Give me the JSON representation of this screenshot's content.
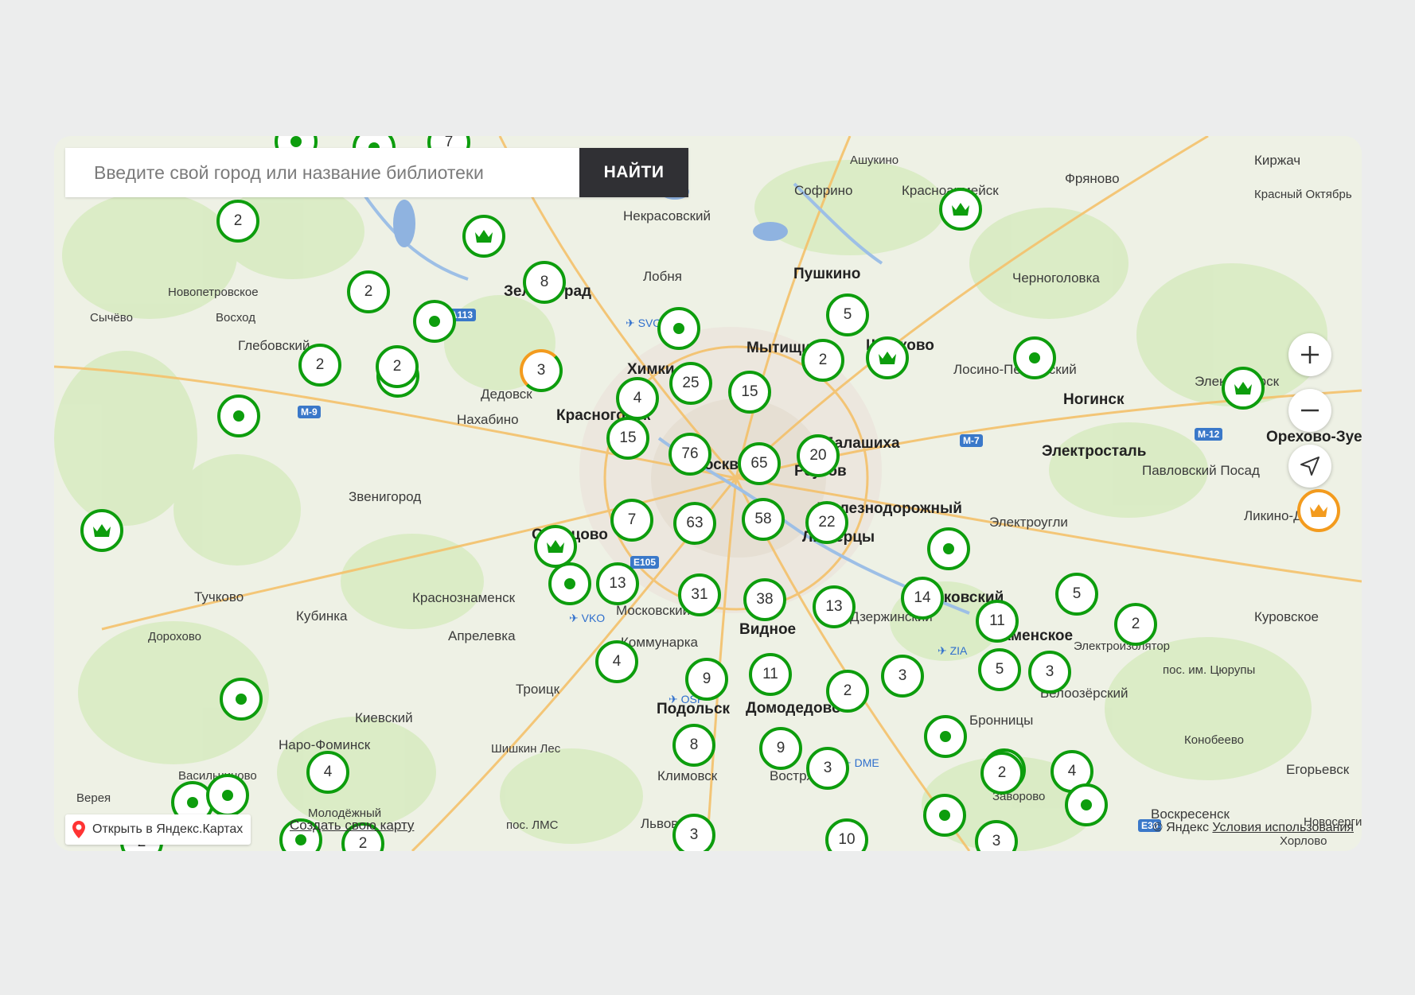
{
  "search": {
    "placeholder": "Введите свой город или название библиотеки",
    "button_label": "НАЙТИ"
  },
  "map_labels": [
    {
      "text": "Ашукино",
      "kind": "small"
    },
    {
      "text": "Софрино",
      "kind": "normal"
    },
    {
      "text": "Красноармейск",
      "kind": "normal"
    },
    {
      "text": "Фряново",
      "kind": "normal"
    },
    {
      "text": "Киржач",
      "kind": "normal"
    },
    {
      "text": "Красный Октябрь",
      "kind": "small"
    },
    {
      "text": "Некрасовский",
      "kind": "normal"
    },
    {
      "text": "Пушкино",
      "kind": "major"
    },
    {
      "text": "Черноголовка",
      "kind": "normal"
    },
    {
      "text": "Лобня",
      "kind": "normal"
    },
    {
      "text": "Зеленоград",
      "kind": "major"
    },
    {
      "text": "Новопетровское",
      "kind": "small"
    },
    {
      "text": "Сычёво",
      "kind": "small"
    },
    {
      "text": "Восход",
      "kind": "small"
    },
    {
      "text": "Глебовский",
      "kind": "normal"
    },
    {
      "text": "Мытищи",
      "kind": "major"
    },
    {
      "text": "Щёлково",
      "kind": "major"
    },
    {
      "text": "Лосино-Петровский",
      "kind": "normal"
    },
    {
      "text": "Химки",
      "kind": "major"
    },
    {
      "text": "Дедовск",
      "kind": "normal"
    },
    {
      "text": "Ногинск",
      "kind": "major"
    },
    {
      "text": "Электрогорск",
      "kind": "normal"
    },
    {
      "text": "Нахабино",
      "kind": "normal"
    },
    {
      "text": "Красногорск",
      "kind": "major"
    },
    {
      "text": "Балашиха",
      "kind": "major"
    },
    {
      "text": "Электросталь",
      "kind": "major"
    },
    {
      "text": "Орехово-Зуево",
      "kind": "major"
    },
    {
      "text": "Москва",
      "kind": "major"
    },
    {
      "text": "Реутов",
      "kind": "major"
    },
    {
      "text": "Павловский Посад",
      "kind": "normal"
    },
    {
      "text": "Звенигород",
      "kind": "normal"
    },
    {
      "text": "Железнодорожный",
      "kind": "major"
    },
    {
      "text": "Электроугли",
      "kind": "normal"
    },
    {
      "text": "Ликино-Дулёво",
      "kind": "normal"
    },
    {
      "text": "Одинцово",
      "kind": "major"
    },
    {
      "text": "Люберцы",
      "kind": "major"
    },
    {
      "text": "Тучково",
      "kind": "normal"
    },
    {
      "text": "Краснознаменск",
      "kind": "normal"
    },
    {
      "text": "Московский",
      "kind": "normal"
    },
    {
      "text": "Жуковский",
      "kind": "major"
    },
    {
      "text": "Куровское",
      "kind": "normal"
    },
    {
      "text": "Кубинка",
      "kind": "normal"
    },
    {
      "text": "Видное",
      "kind": "major"
    },
    {
      "text": "Дзержинский",
      "kind": "normal"
    },
    {
      "text": "Раменское",
      "kind": "major"
    },
    {
      "text": "Дорохово",
      "kind": "small"
    },
    {
      "text": "Апрелевка",
      "kind": "normal"
    },
    {
      "text": "Коммунарка",
      "kind": "normal"
    },
    {
      "text": "Электроизолятор",
      "kind": "small"
    },
    {
      "text": "Троицк",
      "kind": "normal"
    },
    {
      "text": "пос. им. Цюрупы",
      "kind": "small"
    },
    {
      "text": "Белоозёрский",
      "kind": "normal"
    },
    {
      "text": "Киевский",
      "kind": "normal"
    },
    {
      "text": "Подольск",
      "kind": "major"
    },
    {
      "text": "Домодедово",
      "kind": "major"
    },
    {
      "text": "Бронницы",
      "kind": "normal"
    },
    {
      "text": "Шишкин Лес",
      "kind": "small"
    },
    {
      "text": "Конобеево",
      "kind": "small"
    },
    {
      "text": "Наро-Фоминск",
      "kind": "normal"
    },
    {
      "text": "Климовск",
      "kind": "normal"
    },
    {
      "text": "Востряково",
      "kind": "normal"
    },
    {
      "text": "Егорьевск",
      "kind": "normal"
    },
    {
      "text": "Васильчиново",
      "kind": "small"
    },
    {
      "text": "Верея",
      "kind": "small"
    },
    {
      "text": "Молодёжный",
      "kind": "small"
    },
    {
      "text": "пос. ЛМС",
      "kind": "small"
    },
    {
      "text": "Львовский",
      "kind": "normal"
    },
    {
      "text": "Заворово",
      "kind": "small"
    },
    {
      "text": "Воскресенск",
      "kind": "normal"
    },
    {
      "text": "Новосергиево",
      "kind": "small"
    },
    {
      "text": "Хорлово",
      "kind": "small"
    }
  ],
  "road_labels": [
    "M-9",
    "A113",
    "M-7",
    "M-12",
    "E105",
    "E30"
  ],
  "airport_labels": [
    "SVO",
    "VKO",
    "OSF",
    "DME",
    "ZIA"
  ],
  "cluster_markers": [
    "7",
    "2",
    "8",
    "2",
    "5",
    "2",
    "2",
    "3",
    "3",
    "2",
    "4",
    "25",
    "15",
    "15",
    "76",
    "65",
    "20",
    "7",
    "63",
    "58",
    "22",
    "13",
    "31",
    "38",
    "13",
    "14",
    "5",
    "11",
    "2",
    "4",
    "9",
    "11",
    "2",
    "3",
    "5",
    "3",
    "8",
    "9",
    "3",
    "2",
    "4",
    "4",
    "2",
    "3",
    "10",
    "3",
    "2",
    "2"
  ],
  "library_marker_count": 15,
  "flagship_marker_count": 7,
  "controls": {
    "zoom_in_icon": "plus-icon",
    "zoom_out_icon": "minus-icon",
    "locate_icon": "navigation-arrow-icon"
  },
  "footer": {
    "open_in_maps": "Открыть в Яндекс.Картах",
    "create_map": "Создать свою карту",
    "copyright": "© Яндекс",
    "terms": "Условия использования"
  },
  "colors": {
    "marker_green": "#0d9d0d",
    "marker_orange": "#f39b1e",
    "button_dark": "#303034",
    "map_background": "#eef1e5"
  }
}
